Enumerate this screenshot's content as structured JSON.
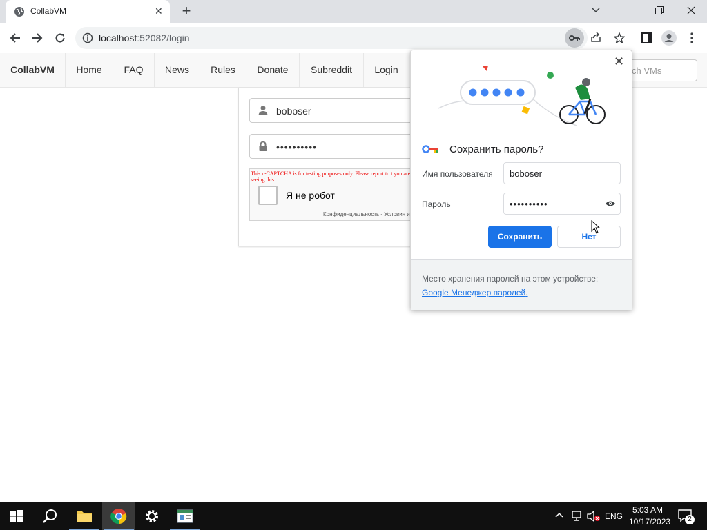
{
  "browser": {
    "tab_title": "CollabVM",
    "tab_close": "✕",
    "new_tab": "+",
    "url_host": "localhost",
    "url_rest": ":52082/login"
  },
  "navbar": {
    "brand": "CollabVM",
    "items": [
      "Home",
      "FAQ",
      "News",
      "Rules",
      "Donate",
      "Subreddit",
      "Login"
    ],
    "search_placeholder": "ch VMs"
  },
  "login": {
    "username": "boboser",
    "password": "••••••••••",
    "captcha_warning": "This reCAPTCHA is for testing purposes only. Please report to t you are seeing this",
    "captcha_label": "Я не робот",
    "captcha_links": "Конфиденциальность - Условия и"
  },
  "password_popup": {
    "heading": "Сохранить пароль?",
    "username_label": "Имя пользователя",
    "username_value": "boboser",
    "password_label": "Пароль",
    "password_value": "••••••••••",
    "save_button": "Сохранить",
    "no_button": "Нет",
    "footer_text": "Место хранения паролей на этом устройстве:",
    "footer_link": "Google Менеджер паролей",
    "footer_period": ".",
    "close": "✕"
  },
  "taskbar": {
    "language": "ENG",
    "time": "5:03 AM",
    "date": "10/17/2023",
    "notification_count": "2"
  },
  "colors": {
    "accent": "#1a73e8",
    "taskbar": "#101010"
  }
}
